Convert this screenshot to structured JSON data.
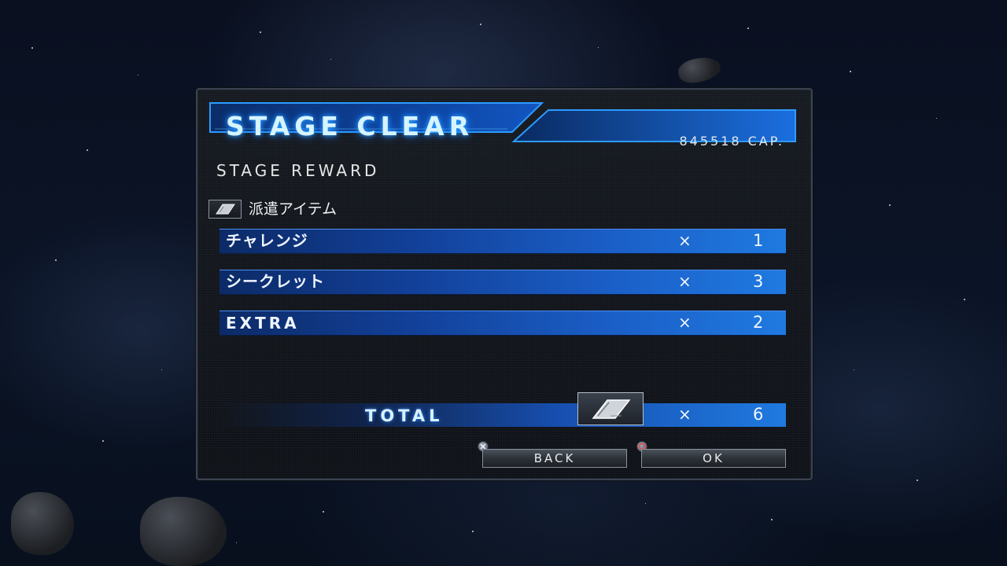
{
  "title": "STAGE CLEAR",
  "capital": "845518 CAP.",
  "section_title": "STAGE REWARD",
  "item_category": "派遣アイテム",
  "rewards": [
    {
      "label": "チャレンジ",
      "times": "×",
      "count": "1"
    },
    {
      "label": "シークレット",
      "times": "×",
      "count": "3"
    },
    {
      "label": "EXTRA",
      "times": "×",
      "count": "2"
    }
  ],
  "total": {
    "label": "TOTAL",
    "times": "×",
    "count": "6"
  },
  "buttons": {
    "back_label": "BACK",
    "back_icon": "cross-button-icon",
    "ok_label": "OK",
    "ok_icon": "circle-button-icon"
  },
  "colors": {
    "title_glow": "#2fa4ff",
    "row_blue": "#1f7ae0",
    "circle_button": "#e0504a",
    "cross_button": "#8fa6d8"
  }
}
